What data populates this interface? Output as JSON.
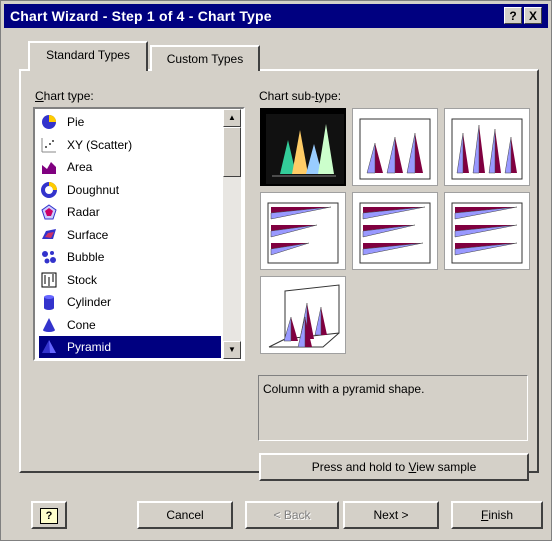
{
  "window": {
    "title": "Chart Wizard - Step 1 of 4 - Chart Type",
    "help_glyph": "?",
    "close_glyph": "X"
  },
  "tabs": [
    {
      "label": "Standard Types",
      "active": true
    },
    {
      "label": "Custom Types",
      "active": false
    }
  ],
  "chart_type": {
    "label_underlined": "C",
    "label_rest": "hart type:",
    "items": [
      {
        "label": "Pie",
        "icon": "pie-icon"
      },
      {
        "label": "XY (Scatter)",
        "icon": "scatter-icon"
      },
      {
        "label": "Area",
        "icon": "area-icon"
      },
      {
        "label": "Doughnut",
        "icon": "doughnut-icon"
      },
      {
        "label": "Radar",
        "icon": "radar-icon"
      },
      {
        "label": "Surface",
        "icon": "surface-icon"
      },
      {
        "label": "Bubble",
        "icon": "bubble-icon"
      },
      {
        "label": "Stock",
        "icon": "stock-icon"
      },
      {
        "label": "Cylinder",
        "icon": "cylinder-icon"
      },
      {
        "label": "Cone",
        "icon": "cone-icon"
      },
      {
        "label": "Pyramid",
        "icon": "pyramid-icon",
        "selected": true
      }
    ]
  },
  "chart_subtype": {
    "label_pre": "Chart sub-",
    "label_underlined": "t",
    "label_post": "ype:",
    "selected_index": 0
  },
  "description": "Column with a pyramid shape.",
  "buttons": {
    "press_pre": "Press and hold to ",
    "press_u": "V",
    "press_post": "iew sample",
    "help": "?",
    "cancel": "Cancel",
    "back": "< Back",
    "next": "Next >",
    "finish_u": "F",
    "finish_rest": "inish"
  },
  "colors": {
    "titlebar": "#000080",
    "dialog": "#d4d0c8",
    "selection": "#000080",
    "pyramid_front": "#800040",
    "pyramid_side": "#9999ff"
  }
}
